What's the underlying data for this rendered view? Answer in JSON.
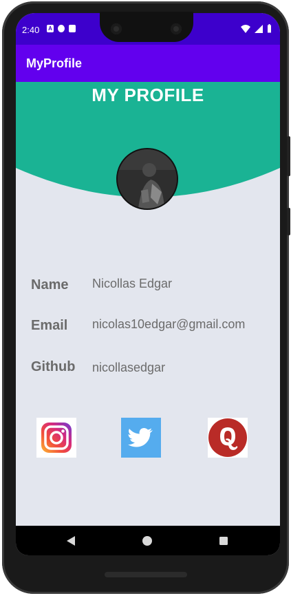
{
  "status_bar": {
    "time": "2:40"
  },
  "app_bar": {
    "title": "MyProfile"
  },
  "header": {
    "title": "MY PROFILE",
    "color": "#1ab394"
  },
  "profile": {
    "rows": [
      {
        "label": "Name",
        "value": "Nicollas Edgar"
      },
      {
        "label": "Email",
        "value": "nicolas10edgar@gmail.com"
      },
      {
        "label": "Github",
        "value": "nicollasedgar"
      }
    ]
  },
  "social": [
    "instagram-icon",
    "twitter-icon",
    "quora-icon"
  ],
  "colors": {
    "status_bar": "#3d00cc",
    "app_bar": "#6200ee",
    "background": "#e3e6ee"
  }
}
